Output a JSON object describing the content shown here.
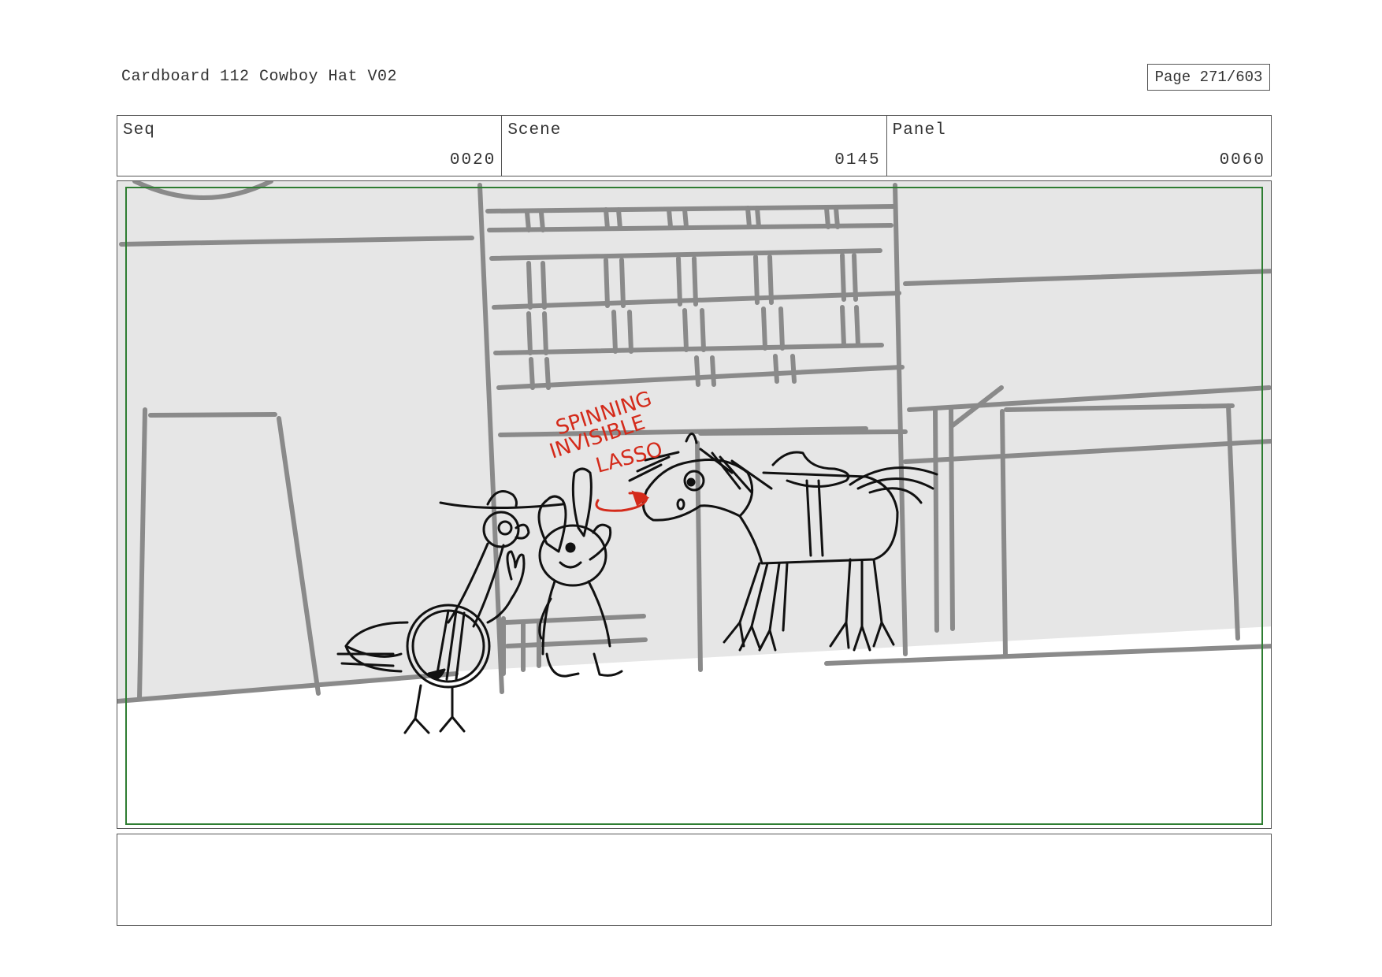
{
  "header": {
    "title": "Cardboard 112 Cowboy Hat V02",
    "page_label": "Page 271/603"
  },
  "info": {
    "seq_label": "Seq",
    "seq_value": "0020",
    "scene_label": "Scene",
    "scene_value": "0145",
    "panel_label": "Panel",
    "panel_value": "0060"
  },
  "panel": {
    "annotation_lines": [
      "SPINNING",
      "INVISIBLE",
      "LASSO"
    ],
    "colors": {
      "background_sketch": "#8a8a8a",
      "wall_fill": "#e6e6e6",
      "ink": "#111111",
      "annotation": "#d42a1a",
      "safe_frame": "#2e7d32"
    }
  },
  "notes": {
    "text": ""
  }
}
